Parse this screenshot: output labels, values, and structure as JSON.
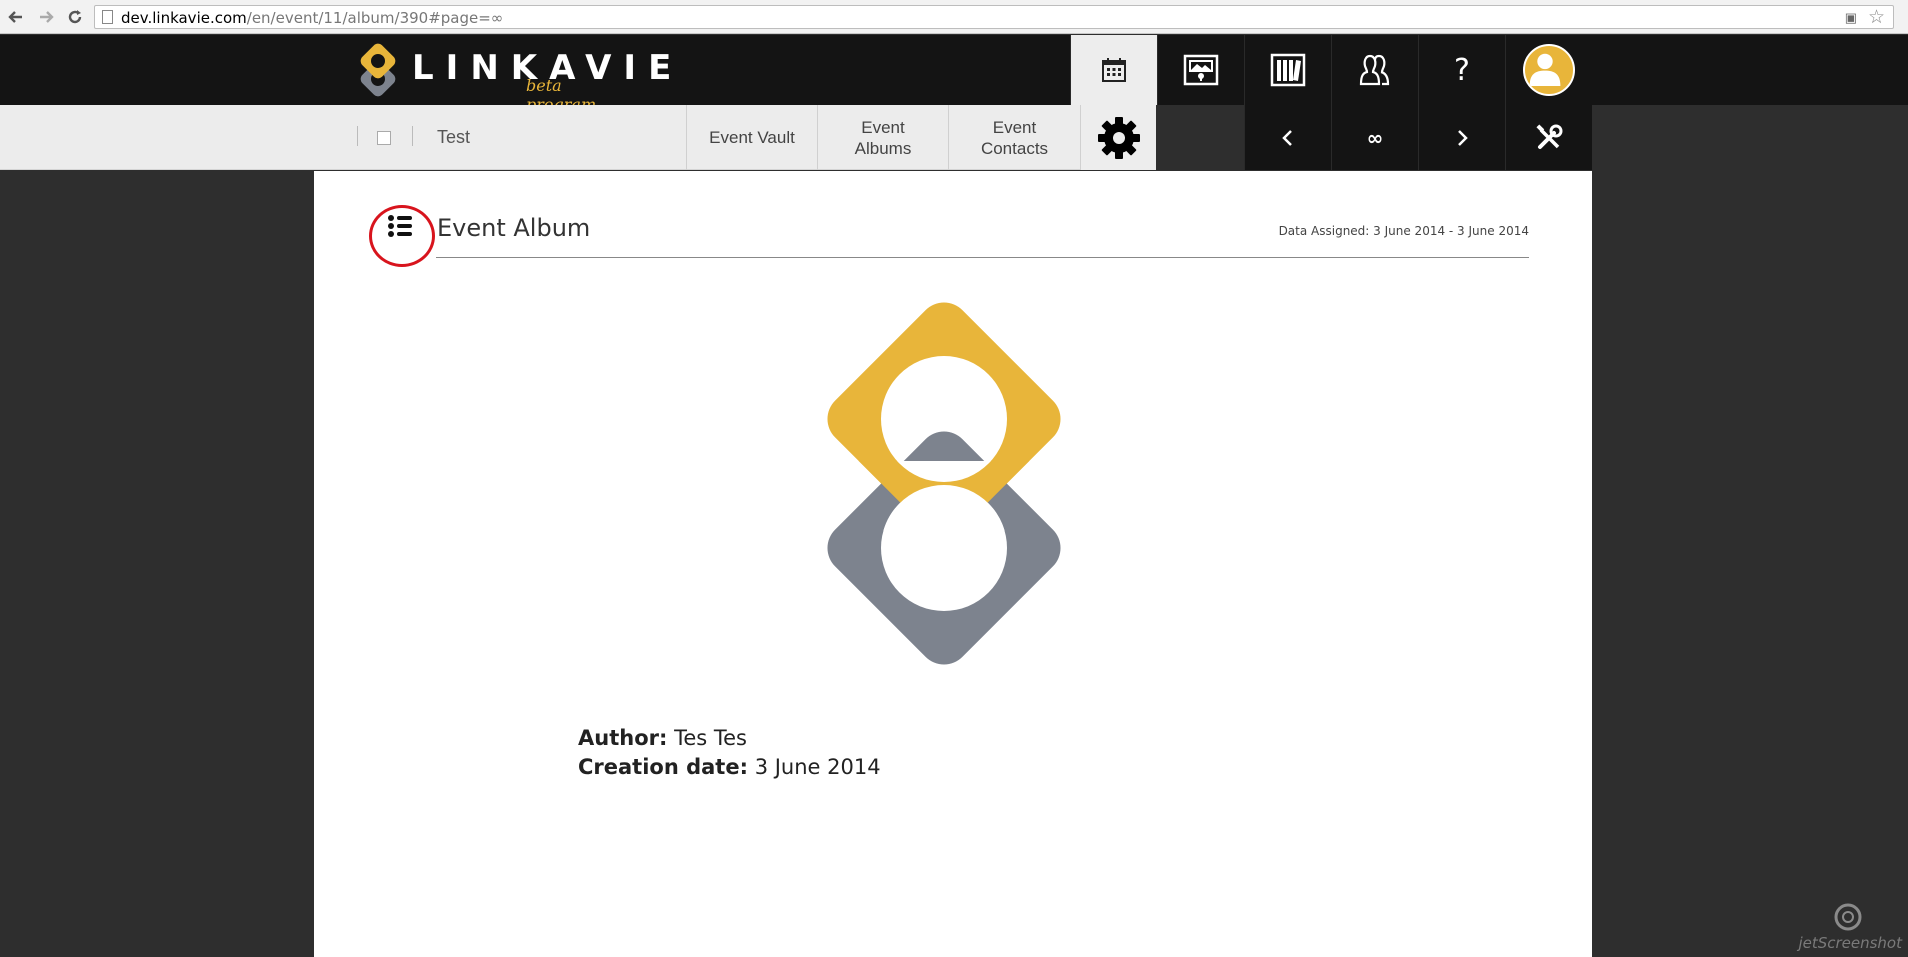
{
  "browser": {
    "url_host": "dev.linkavie.com",
    "url_path": "/en/event/11/album/390#page=∞"
  },
  "brand": {
    "name": "LINKAVIE",
    "subtitle": "beta program",
    "accent": "#e8b53a",
    "secondary": "#7d838e"
  },
  "top_nav": {
    "icons": [
      "calendar-icon",
      "vault-icon",
      "archive-icon",
      "contacts-icon",
      "help-icon",
      "avatar"
    ],
    "help_label": "?"
  },
  "sub_nav": {
    "event_name": "Test",
    "tabs": [
      {
        "label_line1": "Event Vault",
        "label_line2": ""
      },
      {
        "label_line1": "Event",
        "label_line2": "Albums"
      },
      {
        "label_line1": "Event",
        "label_line2": "Contacts"
      }
    ],
    "pager": {
      "prev": "‹",
      "current": "∞",
      "next": "›"
    }
  },
  "album": {
    "title": "Event Album",
    "data_assigned": "Data Assigned: 3 June 2014 - 3 June 2014",
    "author_label": "Author:",
    "author_value": "Tes Tes",
    "creation_label": "Creation date:",
    "creation_value": "3 June 2014"
  },
  "watermark": "jetScreenshot"
}
